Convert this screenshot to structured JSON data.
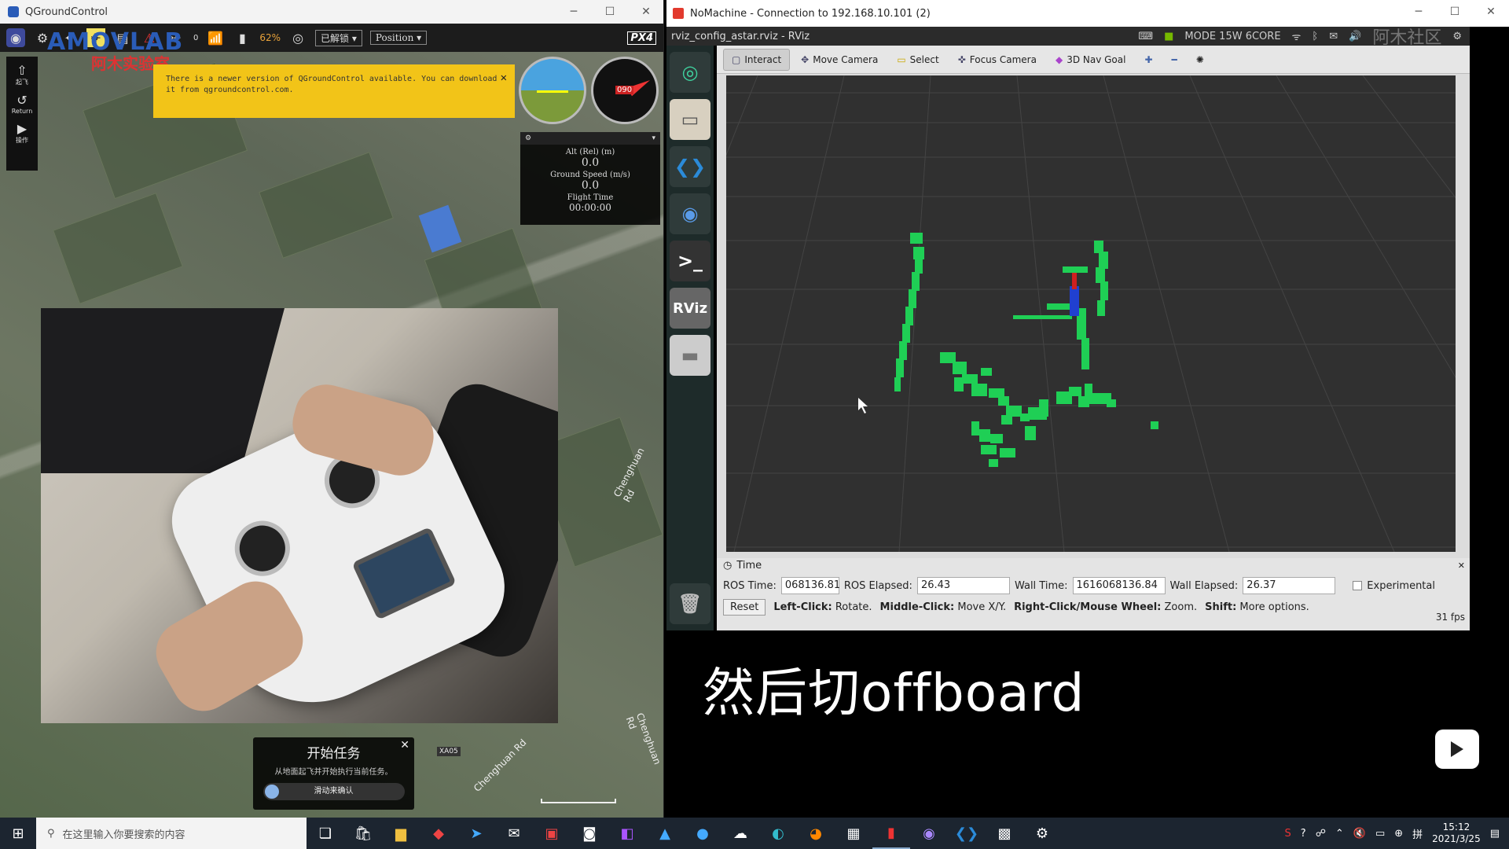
{
  "qgc": {
    "window_title": "QGroundControl",
    "toolbar": {
      "battery": "62%",
      "arm_state": "已解锁",
      "flight_mode": "Position",
      "gps_count": "0",
      "gps_hdop": "0.0",
      "brand_chip": "PX4"
    },
    "left_tools": [
      {
        "icon": "takeoff-icon",
        "label": "起飞"
      },
      {
        "icon": "return-icon",
        "label": "Return"
      },
      {
        "icon": "play-icon",
        "label": "操作"
      }
    ],
    "brand": {
      "name": "AMOVLAB",
      "sub": "阿木实验室"
    },
    "notice": {
      "line1": "There is a newer version of QGroundControl available. You can download",
      "line2": "it from qgroundcontrol.com."
    },
    "telemetry": {
      "alt_label": "Alt (Rel) (m)",
      "alt_value": "0.0",
      "speed_label": "Ground Speed (m/s)",
      "speed_value": "0.0",
      "time_label": "Flight Time",
      "time_value": "00:00:00",
      "compass_heading": "090"
    },
    "map": {
      "road1": "Chenghuan Rd",
      "road2": "Chenghuan Rd",
      "road3": "Chenghuan Rd",
      "tag": "XA05"
    },
    "mission": {
      "title": "开始任务",
      "subtitle": "从地面起飞并开始执行当前任务。",
      "slider": "滑动来确认"
    }
  },
  "nomachine": {
    "window_title": "NoMachine - Connection to 192.168.10.101 (2)",
    "ubuntu_bar_title": "rviz_config_astar.rviz - RViz",
    "ubuntu_status": "MODE 15W 6CORE",
    "watermark": "阿木社区"
  },
  "rviz": {
    "tools": [
      {
        "label": "Interact",
        "icon": "interact-icon",
        "active": true
      },
      {
        "label": "Move Camera",
        "icon": "move-camera-icon",
        "active": false
      },
      {
        "label": "Select",
        "icon": "select-icon",
        "active": false
      },
      {
        "label": "Focus Camera",
        "icon": "focus-camera-icon",
        "active": false
      },
      {
        "label": "3D Nav Goal",
        "icon": "nav-goal-icon",
        "active": false
      }
    ],
    "time_panel": {
      "title": "Time",
      "ros_time_label": "ROS Time:",
      "ros_time": "068136.81",
      "ros_elapsed_label": "ROS Elapsed:",
      "ros_elapsed": "26.43",
      "wall_time_label": "Wall Time:",
      "wall_time": "1616068136.84",
      "wall_elapsed_label": "Wall Elapsed:",
      "wall_elapsed": "26.37",
      "experimental": "Experimental"
    },
    "help": {
      "reset": "Reset",
      "left_bold": "Left-Click:",
      "left_text": "Rotate.",
      "middle_bold": "Middle-Click:",
      "middle_text": "Move X/Y.",
      "right_bold": "Right-Click/Mouse Wheel:",
      "right_text": "Zoom.",
      "shift_bold": "Shift:",
      "shift_text": "More options.",
      "fps": "31 fps"
    },
    "colors": {
      "occupancy": "#1fcf55",
      "grid_bg": "#303030"
    }
  },
  "subtitle": "然后切offboard",
  "taskbar": {
    "search_placeholder": "在这里输入你要搜索的内容",
    "time": "15:12",
    "date": "2021/3/25"
  }
}
